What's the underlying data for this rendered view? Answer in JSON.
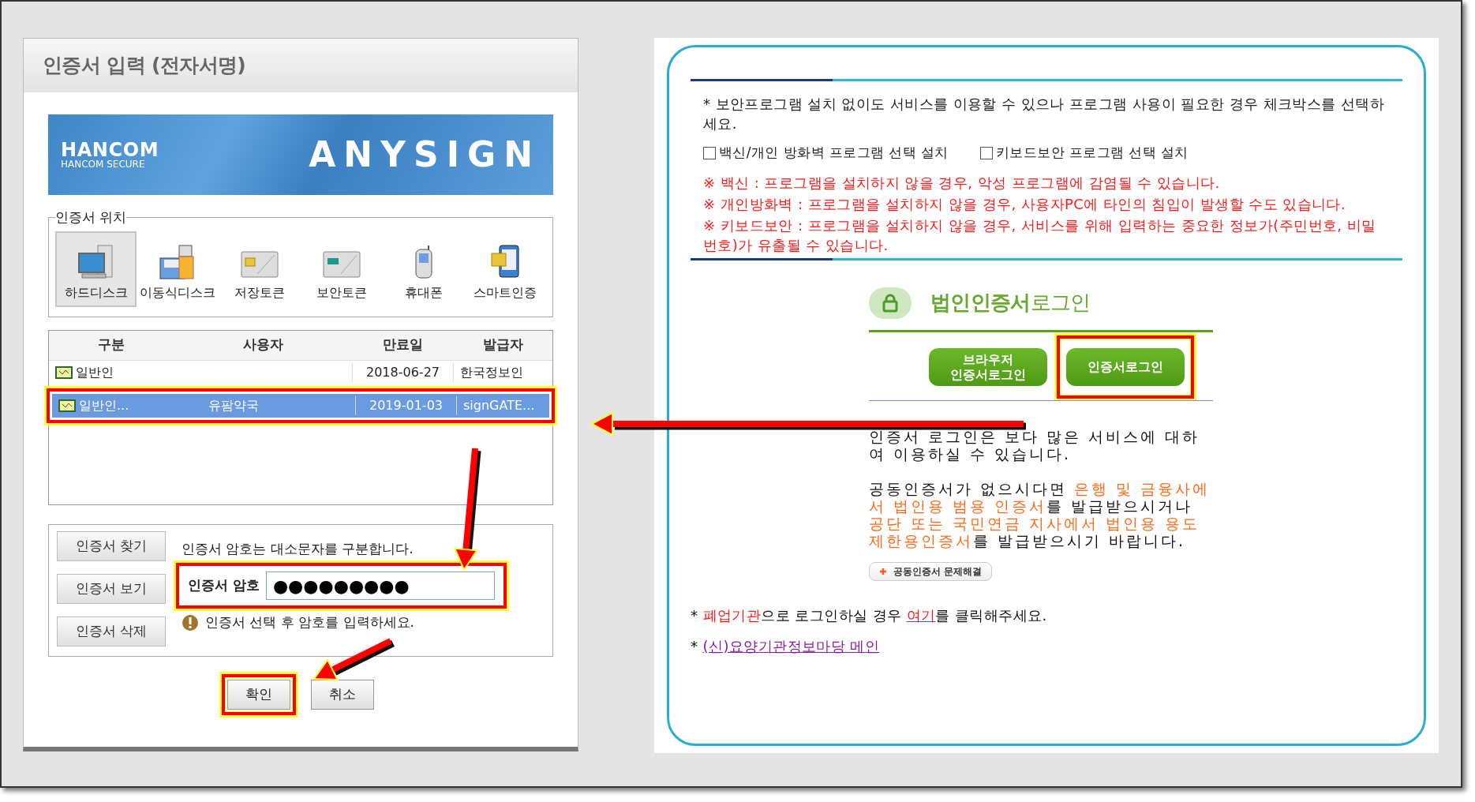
{
  "dialog": {
    "title": "인증서 입력 (전자서명)",
    "banner": {
      "logo": "HANCOM",
      "logo_sub": "HANCOM SECURE",
      "product": "ANYSIGN"
    },
    "location": {
      "legend": "인증서 위치",
      "items": [
        {
          "kind": "harddisk",
          "label": "하드디스크",
          "selected": true
        },
        {
          "kind": "removable",
          "label": "이동식디스크",
          "selected": false
        },
        {
          "kind": "storage-token",
          "label": "저장토큰",
          "selected": false
        },
        {
          "kind": "security-token",
          "label": "보안토큰",
          "selected": false
        },
        {
          "kind": "phone",
          "label": "휴대폰",
          "selected": false
        },
        {
          "kind": "smart",
          "label": "스마트인증",
          "selected": false
        }
      ]
    },
    "table": {
      "columns": [
        "구분",
        "사용자",
        "만료일",
        "발급자"
      ],
      "rows": [
        {
          "type": "일반인",
          "expires": "2018-06-27",
          "issuer": "한국정보인",
          "selected": false,
          "highlighted": false
        },
        {
          "type": "일반인...",
          "user": "유팜약국",
          "expires": "2019-01-03",
          "issuer": "signGATE...",
          "selected": true,
          "highlighted": true
        }
      ]
    },
    "side_buttons": [
      "인증서 찾기",
      "인증서 보기",
      "인증서 삭제"
    ],
    "case_hint": "인증서 암호는 대소문자를 구분합니다.",
    "password": {
      "label": "인증서 암호",
      "value": "●●●●●●●●●",
      "highlighted": true
    },
    "warning": "인증서 선택 후 암호를 입력하세요.",
    "actions": [
      {
        "label": "확인",
        "highlighted": true
      },
      {
        "label": "취소",
        "highlighted": false
      }
    ]
  },
  "panel": {
    "notice": "* 보안프로그램 설치 없이도 서비스를 이용할 수 있으나 프로그램 사용이 필요한 경우 체크박스를 선택하세요.",
    "options": [
      {
        "label": "백신/개인 방화벽 프로그램 선택 설치",
        "checked": false
      },
      {
        "label": "키보드보안 프로그램 선택 설치",
        "checked": false
      }
    ],
    "warnings": [
      "※ 백신 : 프로그램을 설치하지 않을 경우, 악성 프로그램에 감염될 수 있습니다.",
      "※ 개인방화벽 : 프로그램을 설치하지 않을 경우, 사용자PC에 타인의 침입이 발생할 수도 있습니다.",
      "※ 키보드보안 : 프로그램을 설치하지 않을 경우, 서비스를 위해 입력하는 중요한 정보가(주민번호, 비밀번호)가 유출될 수 있습니다."
    ],
    "login": {
      "title": "**법인인증서**로그인",
      "buttons": [
        {
          "label": "브라우저 인증서로그인",
          "highlighted": false
        },
        {
          "label": "인증서로그인",
          "highlighted": true
        }
      ],
      "paragraphs": [
        [
          {
            "kind": "plain",
            "text": "인증서 로그인은 보다 많은 서비스에 대하여 이용하실 수 있습니다."
          }
        ],
        [
          {
            "kind": "plain",
            "text": "공동인증서가 없으시다면 "
          },
          {
            "kind": "orange",
            "text": "은행 및 금융사에서 법인용 범용 인증서"
          },
          {
            "kind": "plain",
            "text": "를 발급받으시거나 "
          },
          {
            "kind": "orange",
            "text": "공단 또는 국민연금 지사에서 법인용 용도제한용인증서"
          },
          {
            "kind": "plain",
            "text": "를 발급받으시기 바랍니다."
          }
        ]
      ],
      "help_button": "공동인증서 문제해결"
    },
    "footer": [
      [
        {
          "kind": "plain",
          "text": "* "
        },
        {
          "kind": "red",
          "text": "폐업기관"
        },
        {
          "kind": "plain",
          "text": "으로 로그인하실 경우 "
        },
        {
          "kind": "link",
          "text": "여기"
        },
        {
          "kind": "plain",
          "text": "를 클릭해주세요."
        }
      ],
      [
        {
          "kind": "plain",
          "text": "* "
        },
        {
          "kind": "visited",
          "text": "(신)요양기관정보마당 메인"
        }
      ]
    ]
  }
}
